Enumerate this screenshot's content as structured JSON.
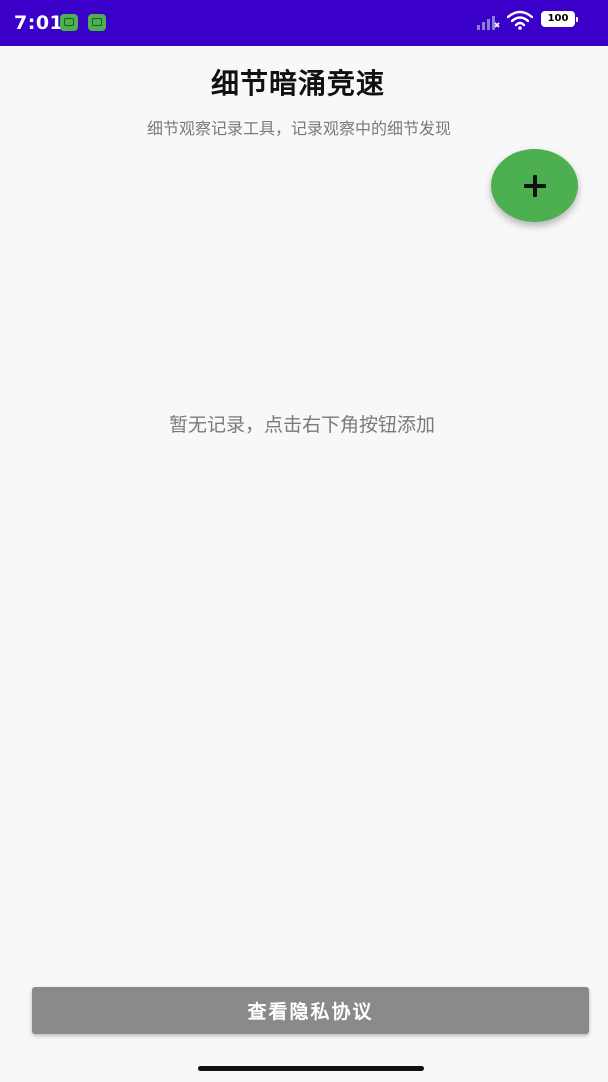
{
  "status_bar": {
    "time": "7:01",
    "battery": "100",
    "icons": [
      "notification-app-icon",
      "notification-app-icon",
      "signal-icon",
      "wifi-icon",
      "battery-icon"
    ]
  },
  "header": {
    "title": "细节暗涌竞速",
    "subtitle": "细节观察记录工具，记录观察中的细节发现"
  },
  "fab": {
    "icon": "plus-icon",
    "color": "#4caf50"
  },
  "main": {
    "empty_message": "暂无记录，点击右下角按钮添加"
  },
  "footer": {
    "privacy_button_label": "查看隐私协议"
  },
  "colors": {
    "status_bar": "#3a00c9",
    "accent": "#4caf50",
    "button": "#8a8a8a"
  }
}
